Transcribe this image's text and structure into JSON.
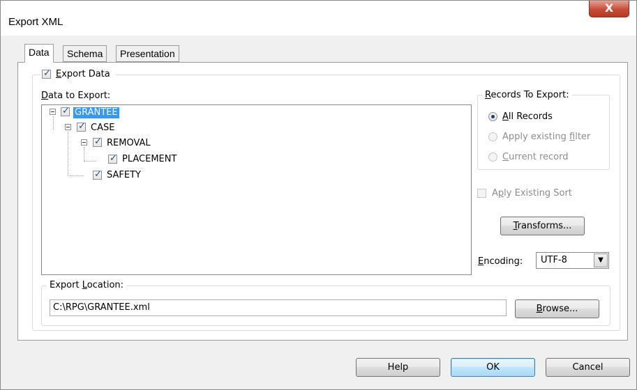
{
  "window": {
    "title": "Export XML",
    "close_glyph": "X"
  },
  "tabs": [
    {
      "label": "Data",
      "active": true
    },
    {
      "label": "Schema",
      "active": false
    },
    {
      "label": "Presentation",
      "active": false
    }
  ],
  "export_data": {
    "label_prefix": "E",
    "label_rest": "xport Data",
    "checked": true
  },
  "data_to_export": {
    "label_prefix": "D",
    "label_rest": "ata to Export:",
    "tree": [
      {
        "label": "GRANTEE",
        "checked": true,
        "selected": true
      },
      {
        "label": "CASE",
        "checked": true
      },
      {
        "label": "REMOVAL",
        "checked": true
      },
      {
        "label": "PLACEMENT",
        "checked": true
      },
      {
        "label": "SAFETY",
        "checked": true
      }
    ]
  },
  "records_to_export": {
    "legend_prefix": "R",
    "legend_rest": "ecords To Export:",
    "options": [
      {
        "prefix": "",
        "accel": "A",
        "rest": "ll Records",
        "checked": true,
        "enabled": true
      },
      {
        "prefix": "Apply existing ",
        "accel": "f",
        "rest": "ilter",
        "checked": false,
        "enabled": false
      },
      {
        "prefix": "",
        "accel": "C",
        "rest": "urrent record",
        "checked": false,
        "enabled": false
      }
    ]
  },
  "apply_existing_sort": {
    "prefix": "Ap",
    "accel": "p",
    "rest": "ly Existing Sort",
    "checked": false,
    "enabled": false
  },
  "transforms_button": {
    "accel": "T",
    "rest": "ransforms..."
  },
  "encoding": {
    "accel": "E",
    "rest": "ncoding:",
    "value": "UTF-8",
    "arrow": "▼"
  },
  "export_location": {
    "legend_prefix": "Export ",
    "legend_accel": "L",
    "legend_rest": "ocation:",
    "path": "C:\\RPG\\GRANTEE.xml"
  },
  "browse_button": {
    "accel": "B",
    "rest": "rowse..."
  },
  "footer_buttons": {
    "help": "Help",
    "ok": "OK",
    "cancel": "Cancel"
  },
  "check_glyph": "✓"
}
